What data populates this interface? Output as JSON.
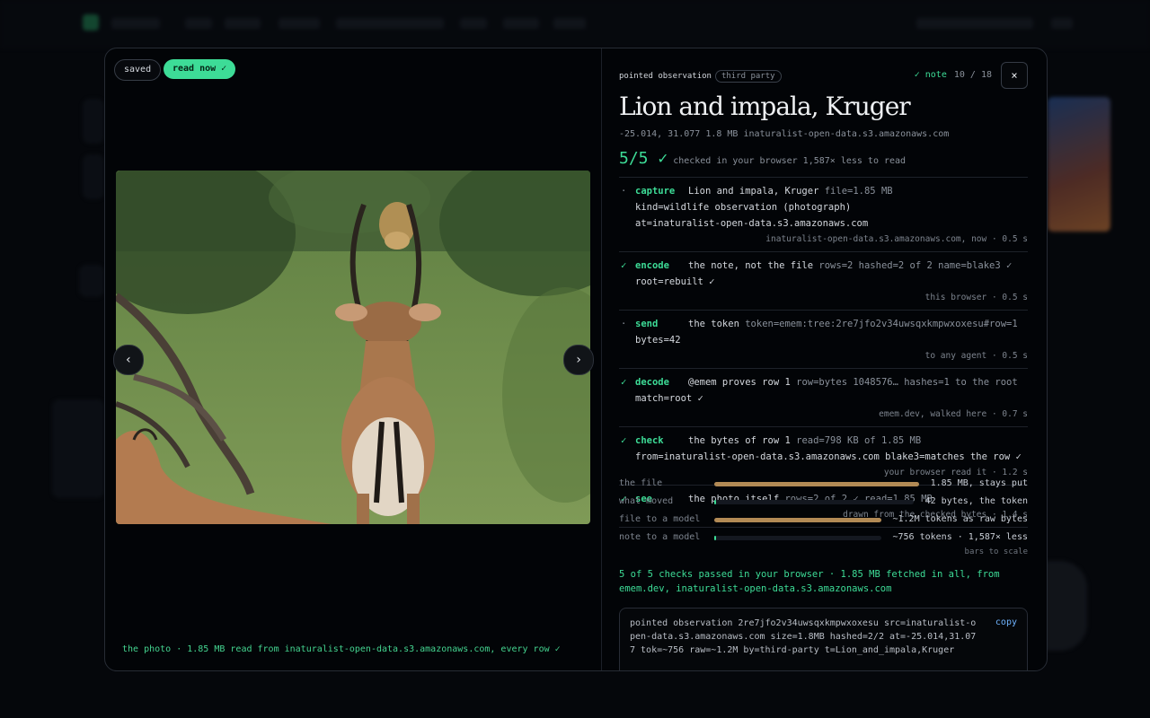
{
  "chips": {
    "saved": "saved",
    "read_now": "read now ✓"
  },
  "nav": {
    "prev": "‹",
    "next": "›"
  },
  "caption": "the photo · 1.85 MB read from inaturalist-open-data.s3.amazonaws.com, every row ✓",
  "header": {
    "label": "pointed observation",
    "tag": "third party",
    "note": "✓ note",
    "count": "10 / 18",
    "close": "×"
  },
  "title": "Lion and impala, Kruger",
  "meta": "-25.014, 31.077  1.8 MB  inaturalist-open-data.s3.amazonaws.com",
  "score": {
    "value": "5/5 ✓",
    "detail": "checked in your browser  1,587× less to read"
  },
  "steps": [
    {
      "mark": "·",
      "name": "capture",
      "text": "Lion and impala, Kruger",
      "extra": "file=1.85 MB",
      "line2": "kind=wildlife observation (photograph)",
      "line3": "at=inaturalist-open-data.s3.amazonaws.com",
      "footer": "inaturalist-open-data.s3.amazonaws.com, now · 0.5 s"
    },
    {
      "mark": "✓",
      "name": "encode",
      "text": "the note, not the file",
      "extra": "rows=2 hashed=2 of 2 name=blake3 ✓",
      "line2": "root=rebuilt ✓",
      "line3": "",
      "footer": "this browser · 0.5 s"
    },
    {
      "mark": "·",
      "name": "send",
      "text": "the token",
      "extra": "token=emem:tree:2re7jfo2v34uwsqxkmpwxoxesu#row=1",
      "line2": "bytes=42",
      "line3": "",
      "footer": "to any agent · 0.5 s"
    },
    {
      "mark": "✓",
      "name": "decode",
      "text": "@emem proves row 1",
      "extra": "row=bytes 1048576… hashes=1 to the root",
      "line2": "match=root ✓",
      "line3": "",
      "footer": "emem.dev, walked here · 0.7 s"
    },
    {
      "mark": "✓",
      "name": "check",
      "text": "the bytes of row 1",
      "extra": "read=798 KB of 1.85 MB",
      "line2": "from=inaturalist-open-data.s3.amazonaws.com blake3=matches the row ✓",
      "line3": "",
      "footer": "your browser read it · 1.2 s"
    },
    {
      "mark": "✓",
      "name": "see",
      "text": "the photo itself",
      "extra": "rows=2 of 2 ✓ read=1.85 MB",
      "line2": "",
      "line3": "",
      "footer": "drawn from the checked bytes · 1.4 s"
    }
  ],
  "bars": [
    {
      "label": "the file",
      "value": "1.85 MB, stays put",
      "fraction": 1.0
    },
    {
      "label": "what moved",
      "value": "42 bytes, the token",
      "fraction": 0.005
    },
    {
      "label": "file to a model",
      "value": "~1.2M tokens as raw bytes",
      "fraction": 1.0
    },
    {
      "label": "note to a model",
      "value": "~756 tokens · 1,587× less",
      "fraction": 0.006
    }
  ],
  "scale_note": "bars to scale",
  "summary": "5 of 5 checks passed in your browser · 1.85 MB fetched in all, from emem.dev, inaturalist-open-data.s3.amazonaws.com",
  "code": "pointed observation 2re7jfo2v34uwsqxkmpwxoxesu src=inaturalist-open-data.s3.amazonaws.com size=1.8MB hashed=2/2 at=-25.014,31.077 tok=~756 raw=~1.2M by=third-party t=Lion_and_impala,Kruger",
  "copy": "copy",
  "colors": {
    "accent": "#3ddc97",
    "bar": "#b28a55",
    "link": "#6fb3ff"
  }
}
